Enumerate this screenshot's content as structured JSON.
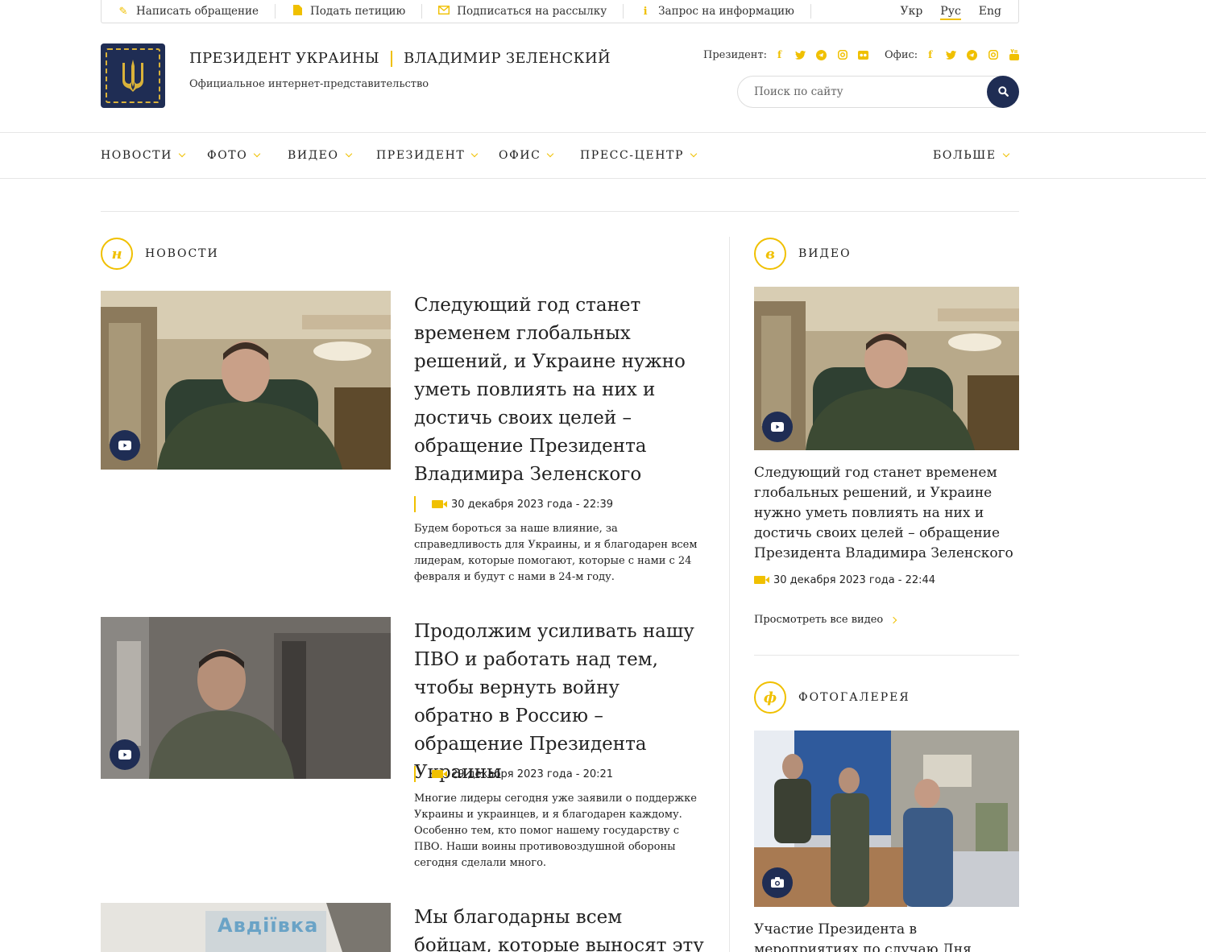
{
  "topbar": {
    "links": [
      {
        "label": "Написать обращение",
        "icon": "pencil-icon"
      },
      {
        "label": "Подать петицию",
        "icon": "document-icon"
      },
      {
        "label": "Подписаться на рассылку",
        "icon": "envelope-icon"
      },
      {
        "label": "Запрос на информацию",
        "icon": "info-icon"
      }
    ],
    "languages": [
      "Укр",
      "Рус",
      "Eng"
    ],
    "active_language": "Рус"
  },
  "header": {
    "title_left": "ПРЕЗИДЕНТ УКРАИНЫ",
    "title_right": "ВЛАДИМИР ЗЕЛЕНСКИЙ",
    "subtitle": "Официальное интернет-представительство",
    "president_label": "Президент:",
    "office_label": "Офис:",
    "president_socials": [
      "facebook-icon",
      "twitter-icon",
      "telegram-icon",
      "instagram-icon",
      "flickr-icon"
    ],
    "office_socials": [
      "facebook-icon",
      "twitter-icon",
      "telegram-icon",
      "instagram-icon",
      "youtube-icon"
    ],
    "search_placeholder": "Поиск по сайту"
  },
  "nav": {
    "items": [
      "НОВОСТИ",
      "ФОТО",
      "ВИДЕО",
      "ПРЕЗИДЕНТ",
      "ОФИС",
      "ПРЕСС-ЦЕНТР"
    ],
    "more": "БОЛЬШЕ"
  },
  "news": {
    "section_letter": "н",
    "section_title": "НОВОСТИ",
    "items": [
      {
        "title": "Следующий год станет временем глобальных решений, и Украине нужно уметь повлиять на них и достичь своих целей – обращение Президента Владимира Зеленского",
        "date": "30 декабря 2023 года - 22:39",
        "text": "Будем бороться за наше влияние, за справедливость для Украины, и я благодарен всем лидерам, которые помогают, которые с нами с 24 февраля и будут с нами в 24-м году."
      },
      {
        "title": "Продолжим усиливать нашу ПВО и работать над тем, чтобы вернуть войну обратно в Россию – обращение Президента Украины",
        "date": "29 декабря 2023 года - 20:21",
        "text": "Многие лидеры сегодня уже заявили о поддержке Украины и украинцев, и я благодарен каждому. Особенно тем, кто помог нашему государству с ПВО. Наши воины противовоздушной обороны сегодня сделали много."
      },
      {
        "title": "Мы благодарны всем бойцам, которые выносят эту войну на",
        "image_text": "Авдіївка"
      }
    ]
  },
  "video": {
    "section_letter": "в",
    "section_title": "ВИДЕО",
    "title": "Следующий год станет временем глобальных решений, и Украине нужно уметь повлиять на них и достичь своих целей – обращение Президента Владимира Зеленского",
    "date": "30 декабря 2023 года - 22:44",
    "view_all": "Просмотреть все видео"
  },
  "gallery": {
    "section_letter": "ф",
    "section_title": "ФОТОГАЛЕРЕЯ",
    "title": "Участие Президента в мероприятиях по случаю Дня энергетика"
  },
  "colors": {
    "accent": "#f0c000",
    "navy": "#1f2d54"
  }
}
